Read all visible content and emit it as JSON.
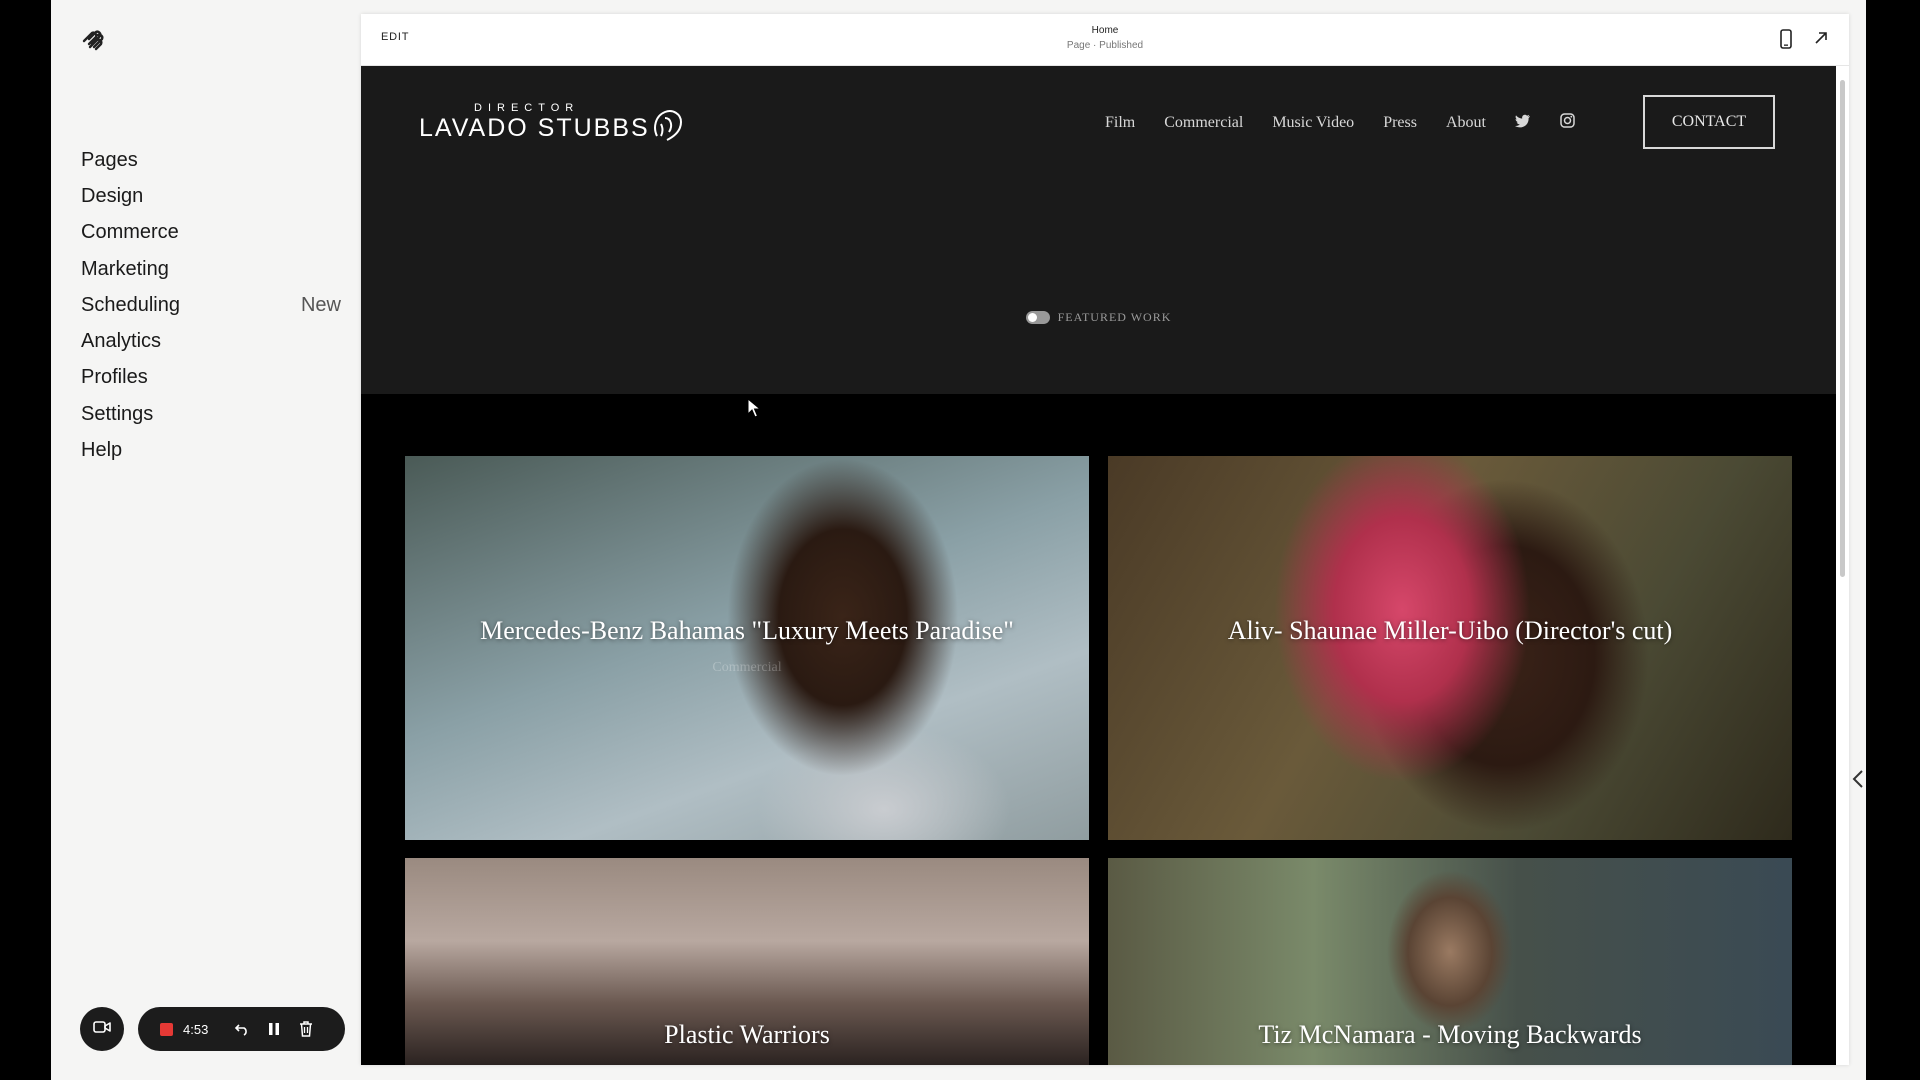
{
  "sidebar": {
    "nav": [
      {
        "label": "Pages"
      },
      {
        "label": "Design"
      },
      {
        "label": "Commerce"
      },
      {
        "label": "Marketing"
      },
      {
        "label": "Scheduling",
        "badge": "New"
      },
      {
        "label": "Analytics"
      },
      {
        "label": "Profiles"
      },
      {
        "label": "Settings"
      },
      {
        "label": "Help"
      }
    ]
  },
  "recorder": {
    "time": "4:53"
  },
  "editor": {
    "edit_label": "EDIT",
    "page_title": "Home",
    "page_status": "Page · Published"
  },
  "site": {
    "brand_sub": "DIRECTOR",
    "brand_name": "LAVADO STUBBS",
    "nav": [
      "Film",
      "Commercial",
      "Music Video",
      "Press",
      "About"
    ],
    "contact": "CONTACT",
    "featured": "FEATURED WORK",
    "cards": [
      {
        "title": "Mercedes-Benz Bahamas \"Luxury Meets Paradise\"",
        "category": "Commercial"
      },
      {
        "title": "Aliv- Shaunae Miller-Uibo (Director's cut)"
      },
      {
        "title": "Plastic Warriors"
      },
      {
        "title": "Tiz McNamara - Moving Backwards"
      }
    ]
  },
  "icons": {
    "squarespace": "squarespace-logo-icon",
    "camera": "video-camera-icon",
    "undo": "undo-icon",
    "pause": "pause-icon",
    "trash": "trash-icon",
    "mobile": "mobile-preview-icon",
    "external": "open-external-icon",
    "twitter": "twitter-icon",
    "instagram": "instagram-icon"
  },
  "colors": {
    "record": "#e53935",
    "site_bg": "#1a1a1a",
    "app_bg": "#f5f5f4"
  }
}
